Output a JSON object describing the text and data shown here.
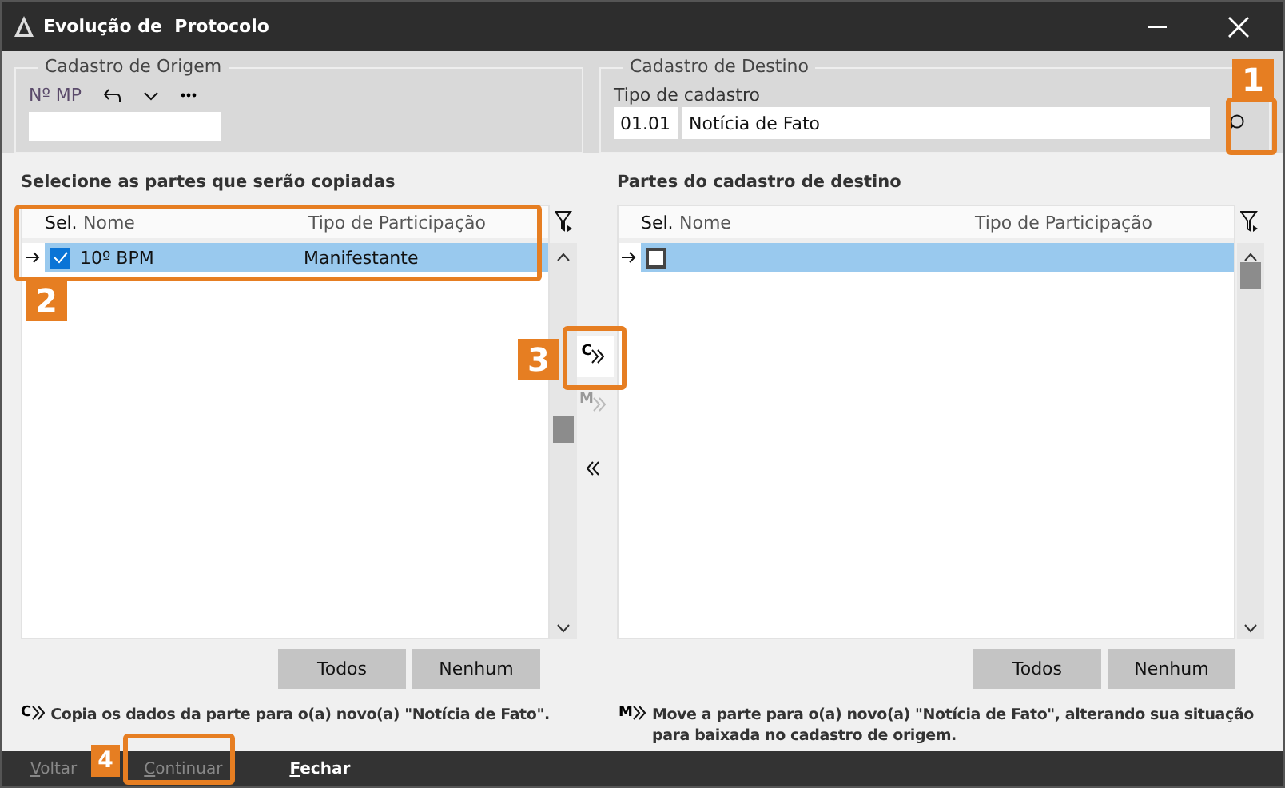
{
  "window": {
    "title": "Evolução de  Protocolo"
  },
  "origin": {
    "legend": "Cadastro de Origem",
    "label": "Nº MP"
  },
  "destination": {
    "legend": "Cadastro de Destino",
    "label": "Tipo de cadastro",
    "code": "01.01",
    "value": "Notícia de Fato"
  },
  "source_table": {
    "title": "Selecione as partes que serão copiadas",
    "columns": [
      "Sel.",
      "Nome",
      "Tipo de Participação"
    ],
    "rows": [
      {
        "name": "10º BPM",
        "role": "Manifestante",
        "checked": true,
        "selected": true
      }
    ],
    "buttons": [
      "Todos",
      "Nenhum"
    ]
  },
  "target_table": {
    "title": "Partes do cadastro de destino",
    "columns": [
      "Sel.",
      "Nome",
      "Tipo de Participação"
    ],
    "rows": [
      {
        "checked": false,
        "selected": true
      }
    ],
    "buttons": [
      "Todos",
      "Nenhum"
    ]
  },
  "transfer_buttons": [
    {
      "kind": "copy",
      "letter": "C",
      "disabled": false
    },
    {
      "kind": "move",
      "letter": "M",
      "disabled": true
    },
    {
      "kind": "back",
      "disabled": false
    }
  ],
  "help": [
    {
      "letter": "C",
      "text": "Copia os dados da parte para o(a) novo(a) \"Notícia de Fato\"."
    },
    {
      "letter": "M",
      "text": "Move a parte para o(a) novo(a) \"Notícia de Fato\", alterando sua situação para baixada no cadastro de origem."
    }
  ],
  "footer": [
    {
      "label": "Voltar",
      "disabled": true
    },
    {
      "label": "Continuar",
      "disabled": true
    },
    {
      "label": "Fechar",
      "disabled": false
    }
  ],
  "annotations": [
    "1",
    "2",
    "3",
    "4"
  ]
}
